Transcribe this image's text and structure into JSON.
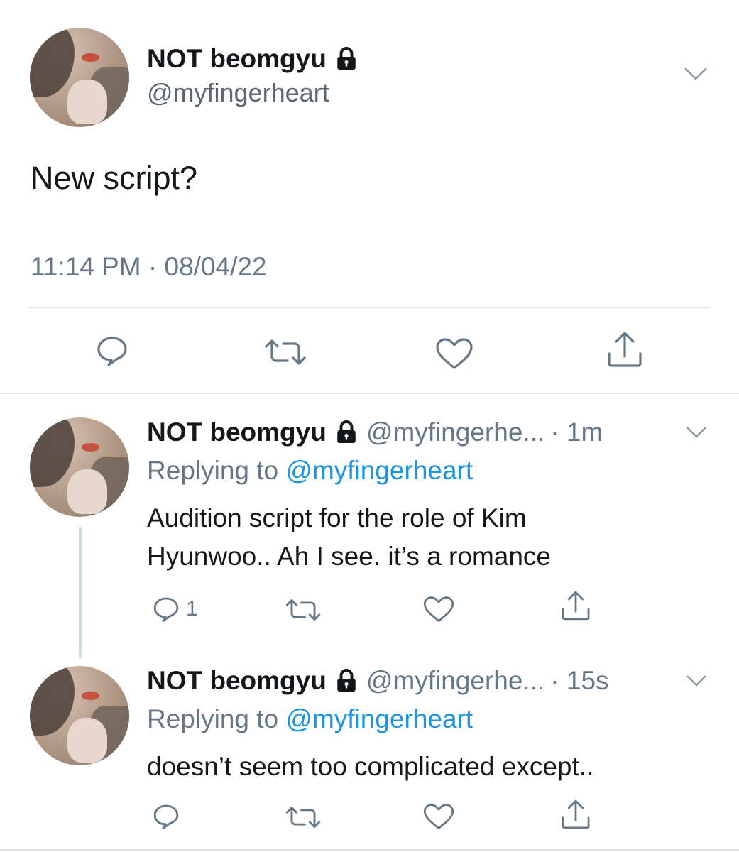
{
  "main_tweet": {
    "display_name": "NOT beomgyu",
    "handle": "@myfingerheart",
    "text": "New script?",
    "timestamp": "11:14 PM · 08/04/22",
    "actions": [
      "reply-icon",
      "retweet-icon",
      "like-icon",
      "share-icon"
    ]
  },
  "replies": [
    {
      "display_name": "NOT beomgyu",
      "handle": "@myfingerhe...",
      "time": "· 1m",
      "replying_prefix": "Replying to",
      "replying_to": "@myfingerheart",
      "text_line1": "Audition script for the role of Kim",
      "text_line2": "Hyunwoo.. Ah I see. it’s a romance",
      "reply_count": "1"
    },
    {
      "display_name": "NOT beomgyu",
      "handle": "@myfingerhe...",
      "time": "· 15s",
      "replying_prefix": "Replying to",
      "replying_to": "@myfingerheart",
      "text_line1": "doesn’t seem too complicated except..",
      "reply_count": ""
    }
  ],
  "colors": {
    "text": "#14171a",
    "secondary": "#657786",
    "link": "#1b95e0",
    "divider": "#dfe3e6"
  }
}
